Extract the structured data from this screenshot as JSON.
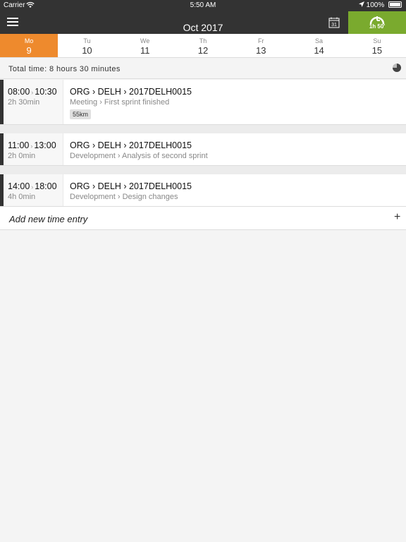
{
  "status": {
    "carrier": "Carrier",
    "time": "5:50 AM",
    "battery": "100%"
  },
  "nav": {
    "title": "Oct 2017",
    "calendar_day": "31",
    "timer_label": "1h 50'"
  },
  "days": [
    {
      "name": "Mo",
      "date": "9"
    },
    {
      "name": "Tu",
      "date": "10"
    },
    {
      "name": "We",
      "date": "11"
    },
    {
      "name": "Th",
      "date": "12"
    },
    {
      "name": "Fr",
      "date": "13"
    },
    {
      "name": "Sa",
      "date": "14"
    },
    {
      "name": "Su",
      "date": "15"
    }
  ],
  "summary": {
    "total": "Total time: 8 hours 30 minutes"
  },
  "entries": [
    {
      "start": "08:00",
      "end": "10:30",
      "duration": "2h 30min",
      "project": "ORG › DELH › 2017DELH0015",
      "task": "Meeting › First sprint finished",
      "badge": "55km"
    },
    {
      "start": "11:00",
      "end": "13:00",
      "duration": "2h 0min",
      "project": "ORG › DELH › 2017DELH0015",
      "task": "Development › Analysis of second sprint"
    },
    {
      "start": "14:00",
      "end": "18:00",
      "duration": "4h 0min",
      "project": "ORG › DELH › 2017DELH0015",
      "task": "Development › Design changes"
    }
  ],
  "add_entry": {
    "label": "Add new time entry"
  },
  "colors": {
    "accent": "#ee8a2d",
    "timer": "#7aaa2e",
    "bar": "#333333"
  }
}
